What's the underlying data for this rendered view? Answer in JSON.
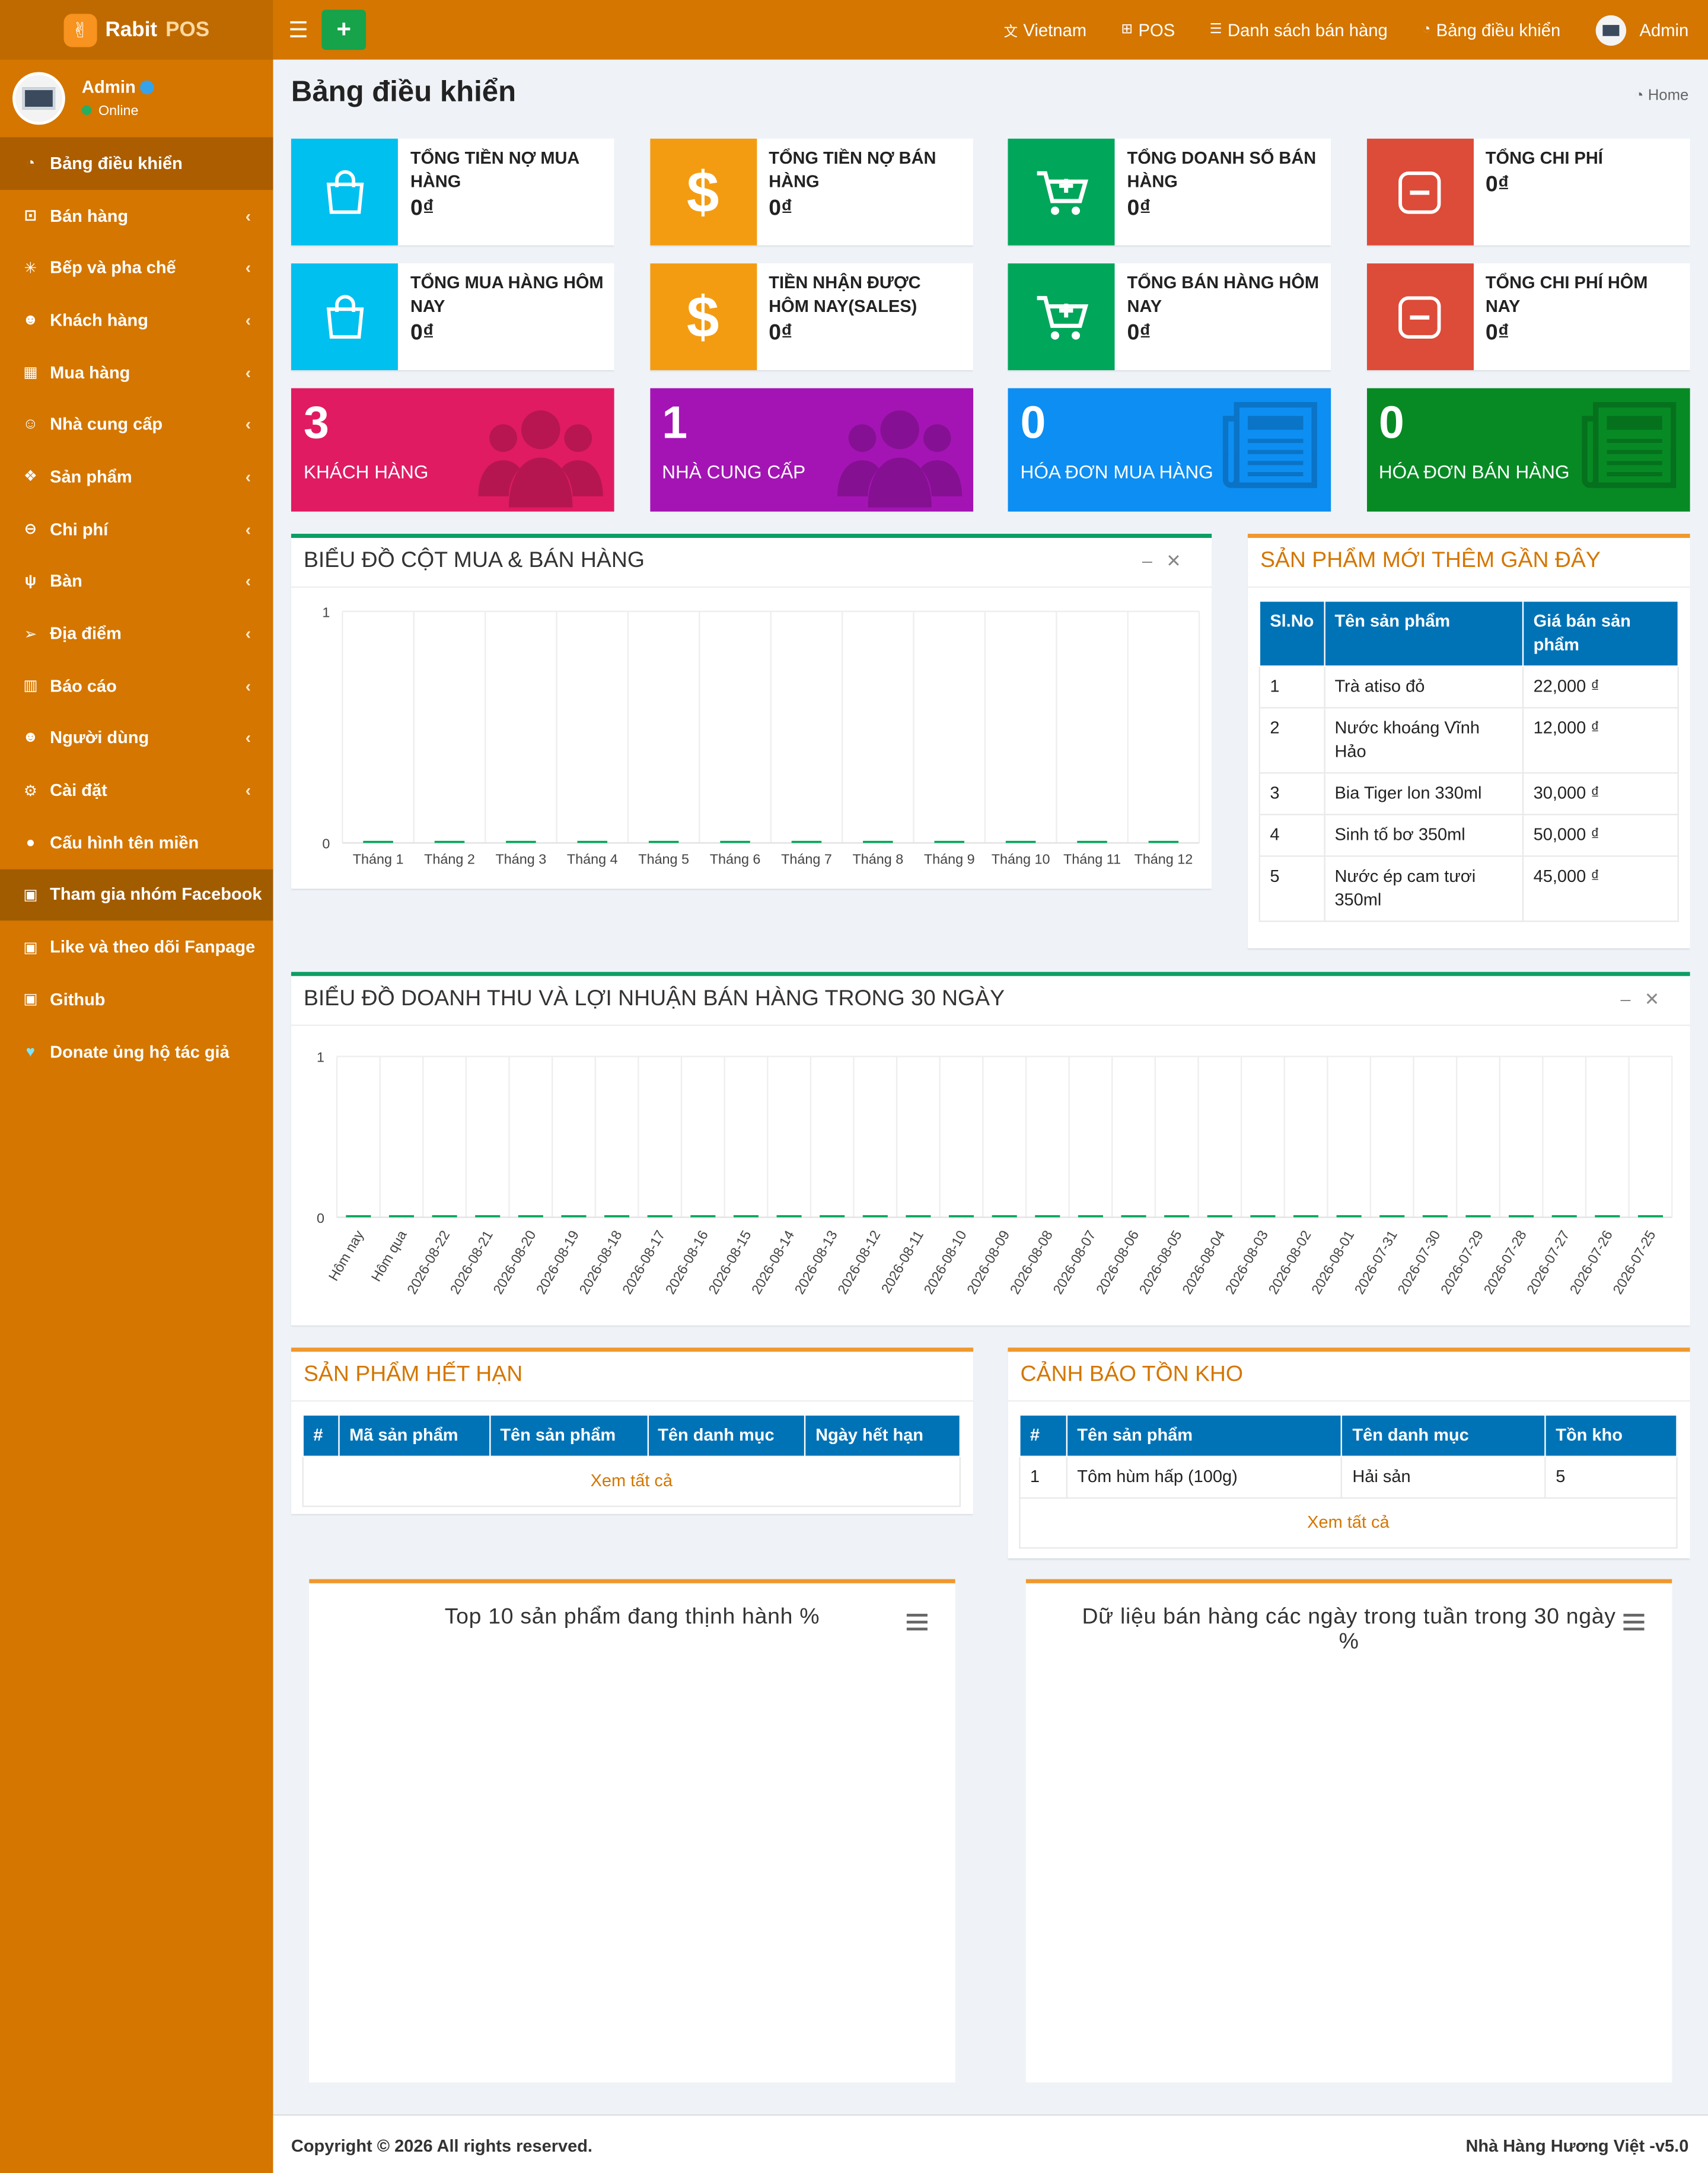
{
  "brand": {
    "name1": "Rabit",
    "name2": "POS"
  },
  "user": {
    "name": "Admin",
    "status": "Online"
  },
  "sidebar": [
    {
      "label": "Bảng điều khiển",
      "icon": "dashboard-icon",
      "glyph": "◔",
      "arrow": false,
      "state": "active"
    },
    {
      "label": "Bán hàng",
      "icon": "cart-icon",
      "glyph": "⊡",
      "arrow": true
    },
    {
      "label": "Bếp và pha chế",
      "icon": "kitchen-icon",
      "glyph": "✳",
      "arrow": true
    },
    {
      "label": "Khách hàng",
      "icon": "users-icon",
      "glyph": "☻",
      "arrow": true
    },
    {
      "label": "Mua hàng",
      "icon": "grid-icon",
      "glyph": "▦",
      "arrow": true
    },
    {
      "label": "Nhà cung cấp",
      "icon": "user-plus-icon",
      "glyph": "☺",
      "arrow": true
    },
    {
      "label": "Sản phẩm",
      "icon": "cubes-icon",
      "glyph": "❖",
      "arrow": true
    },
    {
      "label": "Chi phí",
      "icon": "minus-circle-icon",
      "glyph": "⊖",
      "arrow": true
    },
    {
      "label": "Bàn",
      "icon": "cutlery-icon",
      "glyph": "ψ",
      "arrow": true
    },
    {
      "label": "Địa điểm",
      "icon": "location-arrow-icon",
      "glyph": "➢",
      "arrow": true
    },
    {
      "label": "Báo cáo",
      "icon": "bar-chart-icon",
      "glyph": "▥",
      "arrow": true
    },
    {
      "label": "Người dùng",
      "icon": "users-icon",
      "glyph": "☻",
      "arrow": true
    },
    {
      "label": "Cài đặt",
      "icon": "cogs-icon",
      "glyph": "⚙",
      "arrow": true
    },
    {
      "label": "Cấu hình tên miền",
      "icon": "globe-icon",
      "glyph": "●",
      "arrow": false
    },
    {
      "label": "Tham gia nhóm Facebook",
      "icon": "briefcase-icon",
      "glyph": "▣",
      "arrow": false,
      "state": "hl"
    },
    {
      "label": "Like và theo dõi Fanpage",
      "icon": "briefcase-icon",
      "glyph": "▣",
      "arrow": false
    },
    {
      "label": "Github",
      "icon": "briefcase-icon",
      "glyph": "▣",
      "arrow": false
    },
    {
      "label": "Donate ủng hộ tác giả",
      "icon": "heart-icon",
      "glyph": "♥",
      "arrow": false
    }
  ],
  "topbar": {
    "menu_icon": "☰",
    "add_label": "+",
    "nav": [
      {
        "label": "Vietnam",
        "icon": "language-icon",
        "glyph": "文"
      },
      {
        "label": "POS",
        "icon": "plus-square-icon",
        "glyph": "⊞"
      },
      {
        "label": "Danh sách bán hàng",
        "icon": "list-icon",
        "glyph": "☰"
      },
      {
        "label": "Bảng điều khiển",
        "icon": "dashboard-icon",
        "glyph": "◔"
      }
    ],
    "user": "Admin"
  },
  "page": {
    "title": "Bảng điều khiển",
    "breadcrumb": "Home"
  },
  "info_boxes": [
    {
      "label": "TỔNG TIỀN NỢ MUA HÀNG",
      "value": "0₫",
      "color": "#00c0ef",
      "icon": "shopping-bag-icon"
    },
    {
      "label": "TỔNG TIỀN NỢ BÁN HÀNG",
      "value": "0₫",
      "color": "#f39c12",
      "icon": "dollar-icon"
    },
    {
      "label": "TỔNG DOANH SỐ BÁN HÀNG",
      "value": "0₫",
      "color": "#00a65a",
      "icon": "cart-plus-icon"
    },
    {
      "label": "TỔNG CHI PHÍ",
      "value": "0₫",
      "color": "#dd4b39",
      "icon": "minus-square-icon"
    },
    {
      "label": "TỔNG MUA HÀNG HÔM NAY",
      "value": "0₫",
      "color": "#00c0ef",
      "icon": "shopping-bag-icon"
    },
    {
      "label": "TIỀN NHẬN ĐƯỢC HÔM NAY(SALES)",
      "value": "0₫",
      "color": "#f39c12",
      "icon": "dollar-icon"
    },
    {
      "label": "TỔNG BÁN HÀNG HÔM NAY",
      "value": "0₫",
      "color": "#00a65a",
      "icon": "cart-plus-icon"
    },
    {
      "label": "TỔNG CHI PHÍ HÔM NAY",
      "value": "0₫",
      "color": "#dd4b39",
      "icon": "minus-square-icon"
    }
  ],
  "stat_boxes": [
    {
      "number": "3",
      "label": "KHÁCH HÀNG",
      "color": "#e01b62",
      "icon": "users-icon"
    },
    {
      "number": "1",
      "label": "NHÀ CUNG CẤP",
      "color": "#a414b4",
      "icon": "users-icon"
    },
    {
      "number": "0",
      "label": "HÓA ĐƠN MUA HÀNG",
      "color": "#0d8ef2",
      "icon": "newspaper-icon"
    },
    {
      "number": "0",
      "label": "HÓA ĐƠN BÁN HÀNG",
      "color": "#078a24",
      "icon": "newspaper-icon"
    }
  ],
  "bar_panel": {
    "title": "BIỂU ĐỒ CỘT MUA & BÁN HÀNG"
  },
  "line_panel": {
    "title": "BIỂU ĐỒ DOANH THU VÀ LỢI NHUẬN BÁN HÀNG TRONG 30 NGÀY"
  },
  "new_products": {
    "title": "SẢN PHẨM MỚI THÊM GẦN ĐÂY",
    "headers": [
      "Sl.No",
      "Tên sản phẩm",
      "Giá bán sản phẩm"
    ],
    "rows": [
      [
        "1",
        "Trà atiso đỏ",
        "22,000 ₫"
      ],
      [
        "2",
        "Nước khoáng Vĩnh Hảo",
        "12,000 ₫"
      ],
      [
        "3",
        "Bia Tiger lon 330ml",
        "30,000 ₫"
      ],
      [
        "4",
        "Sinh tố bơ 350ml",
        "50,000 ₫"
      ],
      [
        "5",
        "Nước ép cam tươi 350ml",
        "45,000 ₫"
      ]
    ]
  },
  "expired": {
    "title": "SẢN PHẨM HẾT HẠN",
    "headers": [
      "#",
      "Mã sản phẩm",
      "Tên sản phẩm",
      "Tên danh mục",
      "Ngày hết hạn"
    ],
    "link": "Xem tất cả"
  },
  "stock": {
    "title": "CẢNH BÁO TỒN KHO",
    "headers": [
      "#",
      "Tên sản phẩm",
      "Tên danh mục",
      "Tồn kho"
    ],
    "rows": [
      [
        "1",
        "Tôm hùm hấp (100g)",
        "Hải sản",
        "5"
      ]
    ],
    "link": "Xem tất cả"
  },
  "pie1": {
    "title": "Top 10 sản phẩm đang thịnh hành %"
  },
  "pie2": {
    "title": "Dữ liệu bán hàng các ngày trong tuần trong 30 ngày %"
  },
  "footer": {
    "left": "Copyright © 2026 All rights reserved.",
    "right": "Nhà Hàng Hương Việt -v5.0"
  },
  "chart_data": [
    {
      "type": "bar",
      "categories": [
        "Tháng 1",
        "Tháng 2",
        "Tháng 3",
        "Tháng 4",
        "Tháng 5",
        "Tháng 6",
        "Tháng 7",
        "Tháng 8",
        "Tháng 9",
        "Tháng 10",
        "Tháng 11",
        "Tháng 12"
      ],
      "series": [
        {
          "values": [
            0,
            0,
            0,
            0,
            0,
            0,
            0,
            0,
            0,
            0,
            0,
            0
          ],
          "color": "#00a65a"
        },
        {
          "values": [
            0,
            0,
            0,
            0,
            0,
            0,
            0,
            0,
            0,
            0,
            0,
            0
          ],
          "color": "#00c0ef"
        }
      ],
      "ylim": [
        0,
        1
      ],
      "yticks": [
        "0",
        "1"
      ],
      "grid": true
    },
    {
      "type": "bar",
      "categories": [
        "Hôm nay",
        "Hôm qua",
        "2026-08-22",
        "2026-08-21",
        "2026-08-20",
        "2026-08-19",
        "2026-08-18",
        "2026-08-17",
        "2026-08-16",
        "2026-08-15",
        "2026-08-14",
        "2026-08-13",
        "2026-08-12",
        "2026-08-11",
        "2026-08-10",
        "2026-08-09",
        "2026-08-08",
        "2026-08-07",
        "2026-08-06",
        "2026-08-05",
        "2026-08-04",
        "2026-08-03",
        "2026-08-02",
        "2026-08-01",
        "2026-07-31",
        "2026-07-30",
        "2026-07-29",
        "2026-07-28",
        "2026-07-27",
        "2026-07-26",
        "2026-07-25"
      ],
      "series": [
        {
          "values": [
            0,
            0,
            0,
            0,
            0,
            0,
            0,
            0,
            0,
            0,
            0,
            0,
            0,
            0,
            0,
            0,
            0,
            0,
            0,
            0,
            0,
            0,
            0,
            0,
            0,
            0,
            0,
            0,
            0,
            0,
            0
          ],
          "color": "#00a65a"
        },
        {
          "values": [
            0,
            0,
            0,
            0,
            0,
            0,
            0,
            0,
            0,
            0,
            0,
            0,
            0,
            0,
            0,
            0,
            0,
            0,
            0,
            0,
            0,
            0,
            0,
            0,
            0,
            0,
            0,
            0,
            0,
            0,
            0
          ],
          "color": "#00c0ef"
        }
      ],
      "ylim": [
        0,
        1
      ],
      "yticks": [
        "0",
        "1"
      ],
      "grid": true
    },
    {
      "type": "pie",
      "title": "Top 10 sản phẩm đang thịnh hành %",
      "values": []
    },
    {
      "type": "pie",
      "title": "Dữ liệu bán hàng các ngày trong tuần trong 30 ngày %",
      "values": []
    }
  ]
}
